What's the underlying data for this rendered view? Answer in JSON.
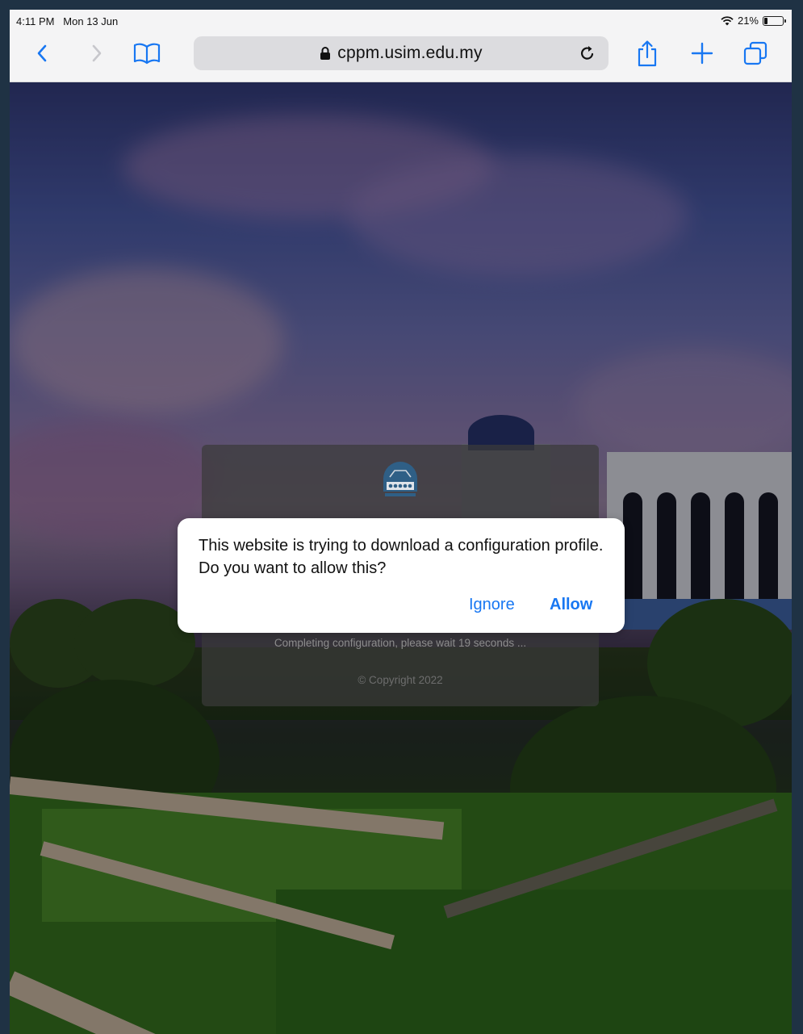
{
  "status_bar": {
    "time": "4:11 PM",
    "date": "Mon 13 Jun",
    "battery_text": "21%",
    "battery_level": 0.21
  },
  "browser": {
    "url": "cppm.usim.edu.my",
    "buttons": {
      "back": "chevron-left-icon",
      "forward": "chevron-right-icon",
      "bookmarks": "book-icon",
      "reload": "reload-icon",
      "share": "share-icon",
      "new_tab": "plus-icon",
      "tabs": "tabs-icon"
    },
    "accent": "#1877f2"
  },
  "page": {
    "progress_text": "Completing configuration, please wait 19 seconds ...",
    "copyright": "© Copyright 2022"
  },
  "alert": {
    "message": "This website is trying to download a configuration profile. Do you want to allow this?",
    "ignore_label": "Ignore",
    "allow_label": "Allow"
  }
}
